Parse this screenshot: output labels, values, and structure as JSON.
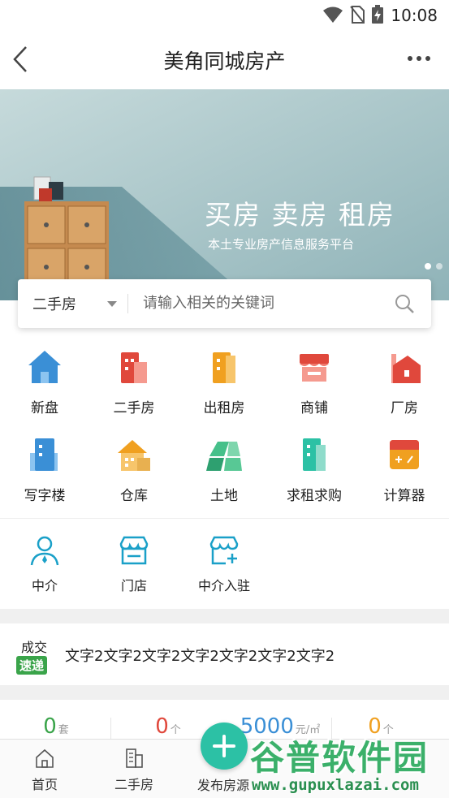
{
  "status_bar": {
    "time": "10:08"
  },
  "header": {
    "title": "美角同城房产"
  },
  "banner": {
    "headline": "买房 卖房 租房",
    "subtitle": "本土专业房产信息服务平台",
    "slide_count": 2,
    "active_slide": 1
  },
  "search": {
    "type_value": "二手房",
    "placeholder": "请输入相关的关键词"
  },
  "categories": [
    {
      "label": "新盘",
      "icon": "house-icon"
    },
    {
      "label": "二手房",
      "icon": "building-icon"
    },
    {
      "label": "出租房",
      "icon": "apartment-icon"
    },
    {
      "label": "商铺",
      "icon": "shop-icon"
    },
    {
      "label": "厂房",
      "icon": "factory-icon"
    },
    {
      "label": "写字楼",
      "icon": "office-icon"
    },
    {
      "label": "仓库",
      "icon": "warehouse-icon"
    },
    {
      "label": "土地",
      "icon": "land-icon"
    },
    {
      "label": "求租求购",
      "icon": "request-icon"
    },
    {
      "label": "计算器",
      "icon": "calculator-icon"
    }
  ],
  "agents": [
    {
      "label": "中介",
      "icon": "agent-icon"
    },
    {
      "label": "门店",
      "icon": "store-icon"
    },
    {
      "label": "中介入驻",
      "icon": "agent-join-icon"
    }
  ],
  "deal": {
    "tag_top": "成交",
    "tag_bottom": "速递",
    "text": "文字2文字2文字2文字2文字2文字2文字2"
  },
  "stats": [
    {
      "value": "0",
      "unit": "套",
      "color": "#3aa44a"
    },
    {
      "value": "0",
      "unit": "个",
      "color": "#e0483c"
    },
    {
      "value": "5000",
      "unit": "元/㎡",
      "color": "#3a8fd6"
    },
    {
      "value": "0",
      "unit": "个",
      "color": "#f0a020"
    }
  ],
  "tabs": [
    {
      "label": "首页",
      "icon": "home-icon"
    },
    {
      "label": "二手房",
      "icon": "building-outline-icon"
    },
    {
      "label": "发布房源",
      "icon": "plus-icon"
    }
  ],
  "watermark": {
    "brand": "谷普软件园",
    "url": "www.gupuxlazai.com"
  },
  "colors": {
    "accent": "#2cc1a5",
    "blue": "#3a8fd6",
    "red": "#e0483c",
    "orange": "#f0a020",
    "green": "#3aa44a"
  }
}
